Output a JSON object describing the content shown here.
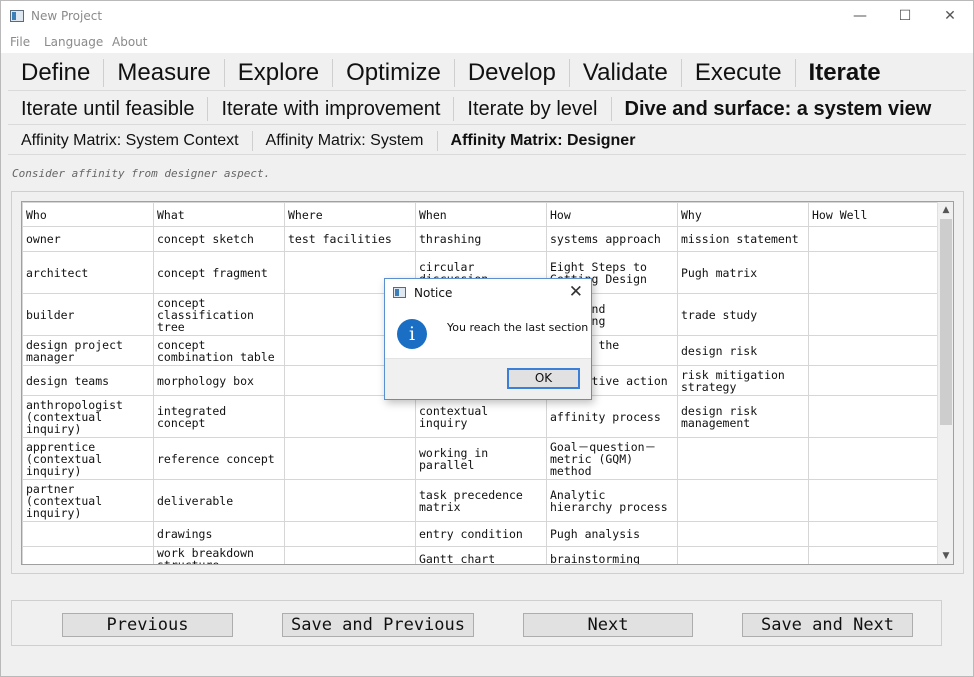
{
  "window": {
    "title": "New Project",
    "min_glyph": "—",
    "max_glyph": "☐",
    "close_glyph": "✕"
  },
  "menu": [
    "File",
    "Language",
    "About"
  ],
  "tabs_main": [
    {
      "label": "Define",
      "active": false
    },
    {
      "label": "Measure",
      "active": false
    },
    {
      "label": "Explore",
      "active": false
    },
    {
      "label": "Optimize",
      "active": false
    },
    {
      "label": "Develop",
      "active": false
    },
    {
      "label": "Validate",
      "active": false
    },
    {
      "label": "Execute",
      "active": false
    },
    {
      "label": "Iterate",
      "active": true
    }
  ],
  "tabs_sub": [
    {
      "label": "Iterate until feasible",
      "active": false
    },
    {
      "label": "Iterate with improvement",
      "active": false
    },
    {
      "label": "Iterate by level",
      "active": false
    },
    {
      "label": "Dive and surface: a system view",
      "active": true
    }
  ],
  "tabs_sub2": [
    {
      "label": "Affinity Matrix: System Context",
      "active": false
    },
    {
      "label": "Affinity Matrix: System",
      "active": false
    },
    {
      "label": "Affinity Matrix: Designer",
      "active": true
    }
  ],
  "description": "Consider affinity from designer aspect.",
  "table": {
    "headers": [
      "Who",
      "What",
      "Where",
      "When",
      "How",
      "Why",
      "How Well"
    ],
    "rows": [
      [
        "owner",
        "concept sketch",
        "test facilities",
        "thrashing",
        "systems approach",
        "mission statement",
        ""
      ],
      [
        "architect",
        "concept fragment",
        "",
        "circular\ndiscussion",
        "Eight Steps to\nGetting Design",
        "Pugh matrix",
        ""
      ],
      [
        "builder",
        "concept\nclassification\ntree",
        "",
        "",
        "Plan and\nplanning",
        "trade study",
        ""
      ],
      [
        "design project\nmanager",
        "concept\ncombination table",
        "",
        "",
        "Making the\ngoals",
        "design risk",
        ""
      ],
      [
        "design teams",
        "morphology box",
        "",
        "",
        "Corrective action",
        "risk mitigation\nstrategy",
        ""
      ],
      [
        "anthropologist\n(contextual\ninquiry)",
        "integrated\nconcept",
        "",
        "contextual\ninquiry",
        "affinity process",
        "design risk\nmanagement",
        ""
      ],
      [
        "apprentice\n(contextual\ninquiry)",
        "reference concept",
        "",
        "working in\nparallel",
        "Goal－question－\nmetric (GQM)\nmethod",
        "",
        ""
      ],
      [
        "partner\n(contextual\ninquiry)",
        "deliverable",
        "",
        "task precedence\nmatrix",
        "Analytic\nhierarchy process",
        "",
        ""
      ],
      [
        "",
        "drawings",
        "",
        "entry condition",
        "Pugh analysis",
        "",
        ""
      ],
      [
        "",
        "work breakdown\nstructure",
        "",
        "Gantt chart",
        "brainstorming",
        "",
        ""
      ]
    ]
  },
  "scroll": {
    "up_glyph": "▲",
    "down_glyph": "▼"
  },
  "buttons": {
    "previous": "Previous",
    "save_previous": "Save and Previous",
    "next": "Next",
    "save_next": "Save and Next"
  },
  "dialog": {
    "title": "Notice",
    "message": "You reach the last section",
    "ok": "OK",
    "close_glyph": "✕",
    "icon_glyph": "i",
    "icon_color": "#1a6fc4"
  }
}
